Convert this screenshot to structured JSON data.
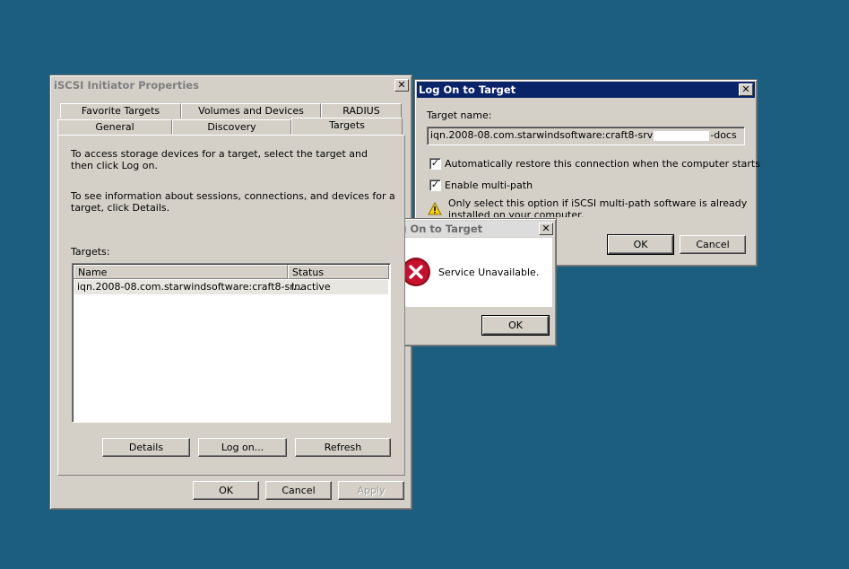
{
  "main_window": {
    "title": "iSCSI Initiator Properties",
    "tabs_back": [
      "Favorite Targets",
      "Volumes and Devices",
      "RADIUS"
    ],
    "tabs_front": [
      "General",
      "Discovery",
      "Targets"
    ],
    "selected_tab": "Targets",
    "intro_text": "To access storage devices for a target, select the target and then click Log on.",
    "details_text": "To see information about sessions, connections, and devices for a target, click Details.",
    "targets_label": "Targets:",
    "columns": [
      "Name",
      "Status"
    ],
    "rows": [
      {
        "name": "iqn.2008-08.com.starwindsoftware:craft8-sr...",
        "status": "Inactive"
      }
    ],
    "details_button": "Details",
    "logon_button": "Log on...",
    "refresh_button": "Refresh",
    "ok_button": "OK",
    "cancel_button": "Cancel",
    "apply_button": "Apply"
  },
  "logon_dialog": {
    "title": "Log On to Target",
    "target_name_label": "Target name:",
    "target_name_value": "iqn.2008-08.com.starwindsoftware:craft8-srv",
    "target_name_suffix": "-docs",
    "auto_restore_label": "Automatically restore this connection when the computer starts",
    "auto_restore_checked": true,
    "multipath_label": "Enable multi-path",
    "multipath_checked": true,
    "warning_text": "Only select this option if iSCSI multi-path software is already installed on your computer.",
    "ok_button": "OK",
    "cancel_button": "Cancel"
  },
  "error_dialog": {
    "title": "Log On to Target",
    "message": "Service Unavailable.",
    "ok_button": "OK"
  },
  "colors": {
    "desktop": "#1b5e7f",
    "active_title": "#0a246a",
    "error_icon": "#c8102e"
  }
}
